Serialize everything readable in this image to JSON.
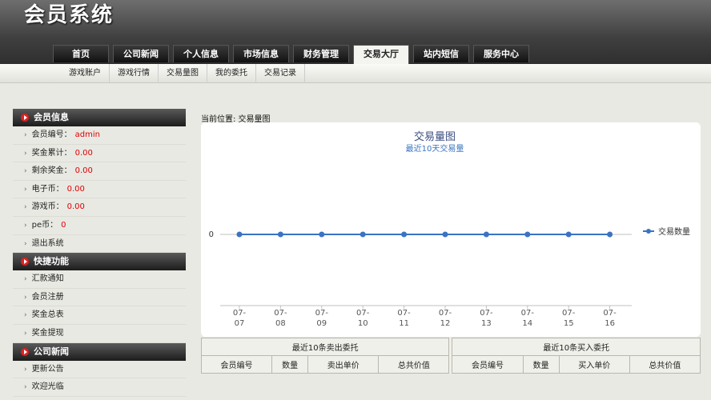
{
  "header": {
    "logo": "会员系统"
  },
  "nav": {
    "tabs": [
      "首页",
      "公司新闻",
      "个人信息",
      "市场信息",
      "财务管理",
      "交易大厅",
      "站内短信",
      "服务中心"
    ],
    "active": 5
  },
  "subnav": {
    "items": [
      "游戏账户",
      "游戏行情",
      "交易量图",
      "我的委托",
      "交易记录"
    ]
  },
  "sidebar": {
    "member": {
      "title": "会员信息",
      "items": [
        {
          "label": "会员编号：",
          "value": "admin"
        },
        {
          "label": "奖金累计：",
          "value": "0.00"
        },
        {
          "label": "剩余奖金：",
          "value": "0.00"
        },
        {
          "label": "电子币：",
          "value": "0.00"
        },
        {
          "label": "游戏币：",
          "value": "0.00"
        },
        {
          "label": "pe币：",
          "value": "0"
        },
        {
          "label": "退出系统",
          "value": ""
        }
      ]
    },
    "quick": {
      "title": "快捷功能",
      "items": [
        "汇款通知",
        "会员注册",
        "奖金总表",
        "奖金提现"
      ]
    },
    "news": {
      "title": "公司新闻",
      "items": [
        "更新公告",
        "欢迎光临"
      ]
    }
  },
  "breadcrumb": "当前位置: 交易量图",
  "chart_data": {
    "type": "line",
    "title": "交易量图",
    "subtitle": "最近10天交易量",
    "categories": [
      "07-07",
      "07-08",
      "07-09",
      "07-10",
      "07-11",
      "07-12",
      "07-13",
      "07-14",
      "07-15",
      "07-16"
    ],
    "series": [
      {
        "name": "交易数量",
        "values": [
          0,
          0,
          0,
          0,
          0,
          0,
          0,
          0,
          0,
          0
        ]
      }
    ],
    "ytick": "0",
    "legend": "right",
    "line_color": "#3a73c2"
  },
  "tables": {
    "sell": {
      "title": "最近10条卖出委托",
      "headers": [
        "会员编号",
        "数量",
        "卖出单价",
        "总共价值"
      ]
    },
    "buy": {
      "title": "最近10条买入委托",
      "headers": [
        "会员编号",
        "数量",
        "买入单价",
        "总共价值"
      ]
    }
  }
}
